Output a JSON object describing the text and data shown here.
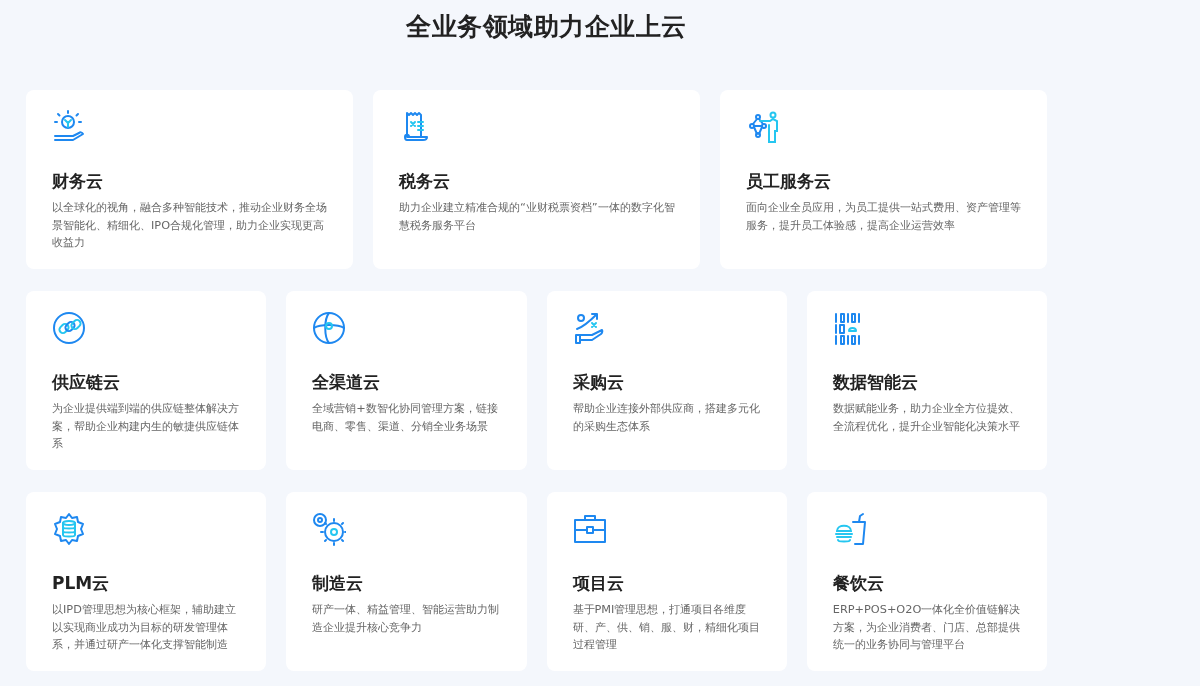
{
  "title": "全业务领域助力企业上云",
  "rows": [
    {
      "cards": [
        {
          "title": "财务云",
          "description": "以全球化的视角，融合多种智能技术，推动企业财务全场景智能化、精细化、IPO合规化管理，助力企业实现更高收益力"
        },
        {
          "title": "税务云",
          "description": "助力企业建立精准合规的“业财税票资档”一体的数字化智慧税务服务平台"
        },
        {
          "title": "员工服务云",
          "description": "面向企业全员应用，为员工提供一站式费用、资产管理等服务，提升员工体验感，提高企业运营效率"
        }
      ]
    },
    {
      "cards": [
        {
          "title": "供应链云",
          "description": "为企业提供端到端的供应链整体解决方案，帮助企业构建内生的敏捷供应链体系"
        },
        {
          "title": "全渠道云",
          "description": "全域营销+数智化协同管理方案，链接电商、零售、渠道、分销全业务场景"
        },
        {
          "title": "采购云",
          "description": "帮助企业连接外部供应商，搭建多元化的采购生态体系"
        },
        {
          "title": "数据智能云",
          "description": "数据赋能业务，助力企业全方位提效、全流程优化，提升企业智能化决策水平"
        }
      ]
    },
    {
      "cards": [
        {
          "title": "PLM云",
          "description": "以IPD管理思想为核心框架，辅助建立以实现商业成功为目标的研发管理体系，并通过研产一体化支撑智能制造"
        },
        {
          "title": "制造云",
          "description": "研产一体、精益管理、智能运营助力制造企业提升核心竞争力"
        },
        {
          "title": "项目云",
          "description": "基于PMI管理思想，打通项目各维度研、产、供、销、服、财，精细化项目过程管理"
        },
        {
          "title": "餐饮云",
          "description": "ERP+POS+O2O一体化全价值链解决方案，为企业消费者、门店、总部提供统一的业务协同与管理平台"
        }
      ]
    }
  ]
}
